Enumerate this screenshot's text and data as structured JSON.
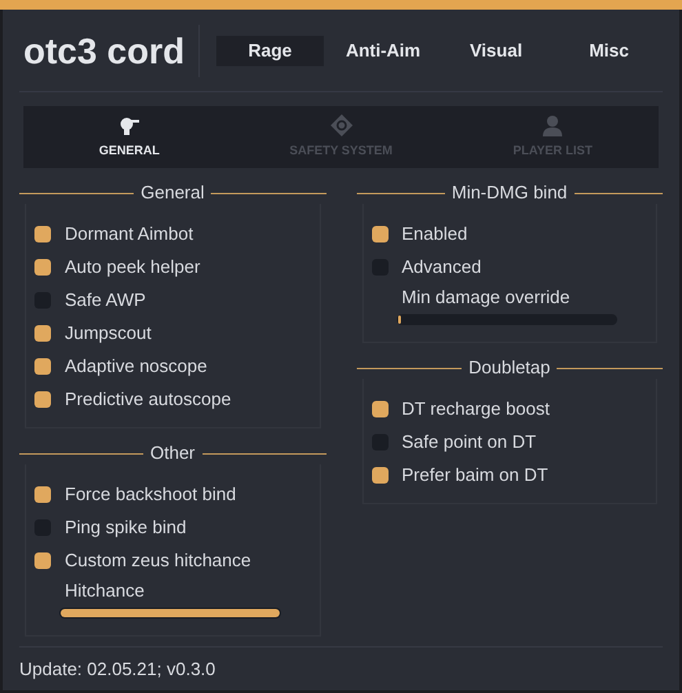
{
  "title": "otc3 cord",
  "tabs": [
    {
      "label": "Rage",
      "selected": true
    },
    {
      "label": "Anti-Aim",
      "selected": false
    },
    {
      "label": "Visual",
      "selected": false
    },
    {
      "label": "Misc",
      "selected": false
    }
  ],
  "subtabs": [
    {
      "label": "GENERAL",
      "selected": true,
      "kind": "gun"
    },
    {
      "label": "SAFETY SYSTEM",
      "selected": false,
      "kind": "target"
    },
    {
      "label": "PLAYER LIST",
      "selected": false,
      "kind": "person"
    }
  ],
  "columns": [
    [
      {
        "title": "General",
        "items": [
          {
            "kind": "checkbox",
            "label": "Dormant Aimbot",
            "checked": true
          },
          {
            "kind": "checkbox",
            "label": "Auto peek helper",
            "checked": true
          },
          {
            "kind": "checkbox",
            "label": "Safe AWP",
            "checked": false
          },
          {
            "kind": "checkbox",
            "label": "Jumpscout",
            "checked": true
          },
          {
            "kind": "checkbox",
            "label": "Adaptive noscope",
            "checked": true
          },
          {
            "kind": "checkbox",
            "label": "Predictive autoscope",
            "checked": true
          }
        ]
      },
      {
        "title": "Other",
        "items": [
          {
            "kind": "checkbox",
            "label": "Force backshoot bind",
            "checked": true
          },
          {
            "kind": "checkbox",
            "label": "Ping spike bind",
            "checked": false
          },
          {
            "kind": "checkbox",
            "label": "Custom zeus hitchance",
            "checked": true
          },
          {
            "kind": "slider",
            "label": "Hitchance",
            "level": 1
          }
        ]
      }
    ],
    [
      {
        "title": "Min-DMG bind",
        "items": [
          {
            "kind": "checkbox",
            "label": "Enabled",
            "checked": true
          },
          {
            "kind": "checkbox",
            "label": "Advanced",
            "checked": false
          },
          {
            "kind": "slider",
            "label": "Min damage override",
            "level": 0.01
          }
        ]
      },
      {
        "title": "Doubletap",
        "items": [
          {
            "kind": "checkbox",
            "label": "DT recharge boost",
            "checked": true
          },
          {
            "kind": "checkbox",
            "label": "Safe point on DT",
            "checked": false
          },
          {
            "kind": "checkbox",
            "label": "Prefer baim on DT",
            "checked": true
          }
        ]
      }
    ]
  ],
  "footer": "Update: 02.05.21; v0.3.0"
}
